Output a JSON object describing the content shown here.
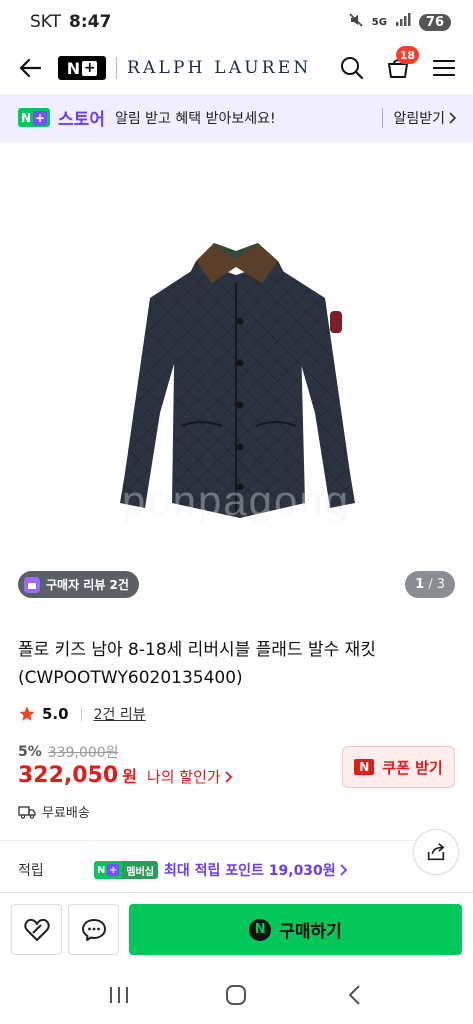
{
  "status_bar": {
    "carrier": "SKT",
    "time": "8:47",
    "network": "5G",
    "battery": "76"
  },
  "header": {
    "brand_logo": "N+",
    "brand_name": "RALPH LAUREN",
    "cart_count": "18"
  },
  "notice": {
    "store_label": "스토어",
    "text": "알림 받고 혜택 받아보세요!",
    "action": "알림받기"
  },
  "gallery": {
    "review_chip": "구매자 리뷰 2건",
    "page_current": "1",
    "page_total": "3"
  },
  "product": {
    "title": "폴로 키즈 남아 8-18세 리버시블 플래드 발수 재킷 (CWPOOTWY6020135400)",
    "rating": "5.0",
    "review_link": "2건 리뷰",
    "discount_rate": "5%",
    "original_price": "339,000원",
    "price": "322,050",
    "currency": "원",
    "my_price_link": "나의 할인가",
    "coupon_label": "쿠폰 받기",
    "coupon_icon_text": "N",
    "shipping": "무료배송"
  },
  "points": {
    "label": "적립",
    "member_badge": "멤버십",
    "text": "최대 적립 포인트 19,030원"
  },
  "purchase_bar": {
    "buy_label": "구매하기",
    "buy_icon_text": "N"
  },
  "colors": {
    "accent_green": "#03c75a",
    "accent_purple": "#6a3df0",
    "price_red": "#e21b1b"
  },
  "icons": [
    "back-arrow-icon",
    "search-icon",
    "cart-icon",
    "menu-icon",
    "chevron-right-icon",
    "star-icon",
    "truck-icon",
    "share-icon",
    "heart-icon",
    "chat-icon",
    "recent-apps-icon",
    "home-icon",
    "back-icon"
  ]
}
